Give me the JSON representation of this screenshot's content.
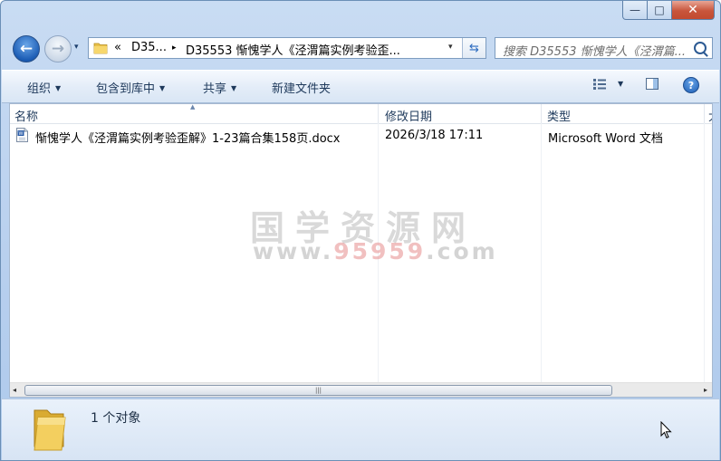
{
  "window": {
    "min_glyph": "—",
    "max_glyph": "□",
    "close_glyph": "✕"
  },
  "nav": {
    "back_glyph": "←",
    "forward_glyph": "→",
    "recent_glyph": "▾",
    "breadcrumb": [
      "«",
      "D35...",
      "▸",
      "D35553 惭愧学人《泾渭篇实例考验歪..."
    ],
    "dropdown_glyph": "▾",
    "refresh_glyph": "⇆",
    "search_placeholder": "搜索 D35553 惭愧学人《泾渭篇..."
  },
  "toolbar": {
    "organize": "组织",
    "include_library": "包含到库中",
    "share": "共享",
    "new_folder": "新建文件夹",
    "arrow": "▼",
    "help": "?"
  },
  "columns": {
    "name": "名称",
    "modified": "修改日期",
    "type": "类型",
    "extra": "大",
    "sort_glyph": "▲"
  },
  "files": [
    {
      "name": "惭愧学人《泾渭篇实例考验歪解》1-23篇合集158页.docx",
      "modified": "2026/3/18 17:11",
      "type": "Microsoft Word 文档",
      "icon": "word-doc-icon"
    }
  ],
  "watermark": {
    "line1": "国学资源网",
    "line2_pre": "www.",
    "line2_num": "95959",
    "line2_post": ".com"
  },
  "scrollbar": {
    "left": "◂",
    "right": "▸",
    "grip": "|||"
  },
  "status": {
    "count": "1 个对象"
  },
  "colors": {
    "accent": "#1c5db5",
    "header_text": "#1e395b",
    "close_red": "#c8553c"
  }
}
